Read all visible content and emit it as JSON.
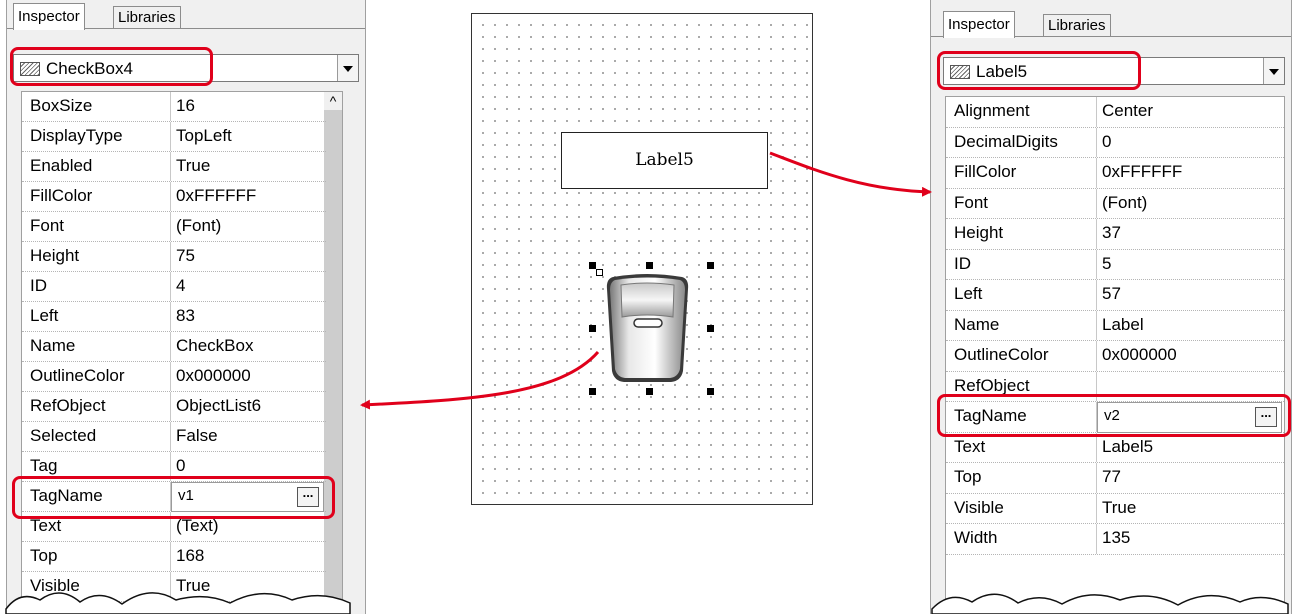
{
  "left_panel": {
    "tabs": [
      "Inspector",
      "Libraries"
    ],
    "active_tab": "Inspector",
    "object_selector": "CheckBox4",
    "properties": [
      {
        "name": "BoxSize",
        "value": "16"
      },
      {
        "name": "DisplayType",
        "value": "TopLeft"
      },
      {
        "name": "Enabled",
        "value": "True"
      },
      {
        "name": "FillColor",
        "value": "0xFFFFFF"
      },
      {
        "name": "Font",
        "value": "(Font)"
      },
      {
        "name": "Height",
        "value": "75"
      },
      {
        "name": "ID",
        "value": "4"
      },
      {
        "name": "Left",
        "value": "83"
      },
      {
        "name": "Name",
        "value": "CheckBox"
      },
      {
        "name": "OutlineColor",
        "value": "0x000000"
      },
      {
        "name": "RefObject",
        "value": "ObjectList6"
      },
      {
        "name": "Selected",
        "value": "False"
      },
      {
        "name": "Tag",
        "value": "0"
      },
      {
        "name": "TagName",
        "value": "v1"
      },
      {
        "name": "Text",
        "value": "(Text)"
      },
      {
        "name": "Top",
        "value": "168"
      },
      {
        "name": "Visible",
        "value": "True"
      }
    ],
    "scroll_up_glyph": "^"
  },
  "right_panel": {
    "tabs": [
      "Inspector",
      "Libraries"
    ],
    "active_tab": "Inspector",
    "object_selector": "Label5",
    "properties": [
      {
        "name": "Alignment",
        "value": "Center"
      },
      {
        "name": "DecimalDigits",
        "value": "0"
      },
      {
        "name": "FillColor",
        "value": "0xFFFFFF"
      },
      {
        "name": "Font",
        "value": "(Font)"
      },
      {
        "name": "Height",
        "value": "37"
      },
      {
        "name": "ID",
        "value": "5"
      },
      {
        "name": "Left",
        "value": "57"
      },
      {
        "name": "Name",
        "value": "Label"
      },
      {
        "name": "OutlineColor",
        "value": "0x000000"
      },
      {
        "name": "RefObject",
        "value": ""
      },
      {
        "name": "TagName",
        "value": "v2"
      },
      {
        "name": "Text",
        "value": "Label5"
      },
      {
        "name": "Top",
        "value": "77"
      },
      {
        "name": "Visible",
        "value": "True"
      },
      {
        "name": "Width",
        "value": "135"
      }
    ]
  },
  "canvas": {
    "label_text": "Label5"
  },
  "ellipsis": "...",
  "colors": {
    "highlight": "#e0001b",
    "panel_bg": "#f0f0f0"
  }
}
